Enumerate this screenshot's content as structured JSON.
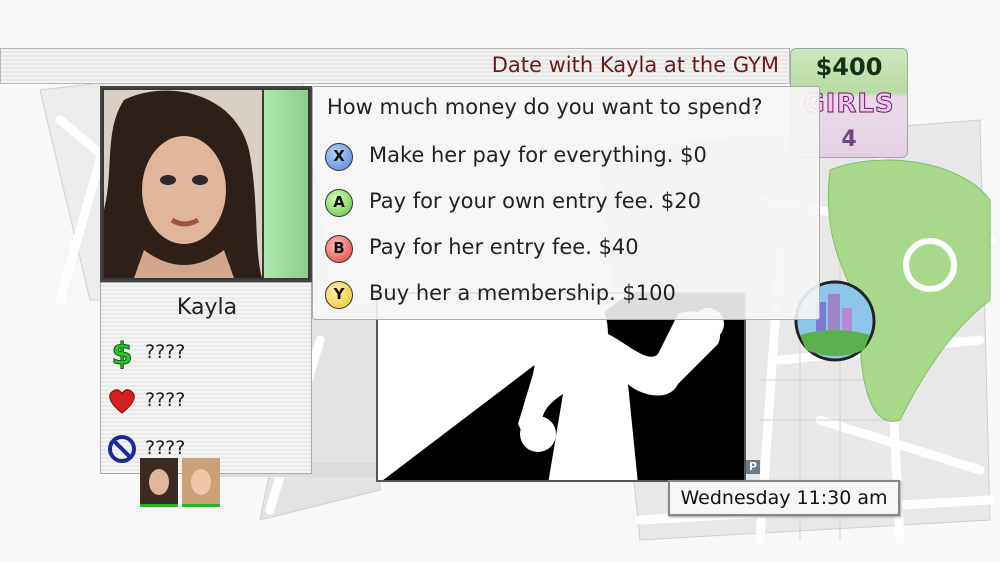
{
  "header": {
    "title": "Date with Kayla at the GYM"
  },
  "stats": {
    "money": "$400",
    "girls_label": "GIRLS",
    "girls_count": "4"
  },
  "girl": {
    "name": "Kayla",
    "money_stat": "????",
    "love_stat": "????",
    "dislike_stat": "????"
  },
  "dialog": {
    "question": "How much money do you want to spend?",
    "options": [
      {
        "button": "X",
        "label": "Make her pay for everything. $0",
        "color": "#4a7fd6"
      },
      {
        "button": "A",
        "label": "Pay for your own entry fee. $20",
        "color": "#5cc03c"
      },
      {
        "button": "B",
        "label": "Pay for her entry fee. $40",
        "color": "#e03a2e"
      },
      {
        "button": "Y",
        "label": "Buy her a membership. $100",
        "color": "#f0c020"
      }
    ]
  },
  "status": {
    "datetime": "Wednesday 11:30 am"
  },
  "map": {
    "parking_label": "P"
  },
  "icons": {
    "money": "dollar-icon",
    "love": "heart-icon",
    "dislike": "no-sign-icon"
  }
}
